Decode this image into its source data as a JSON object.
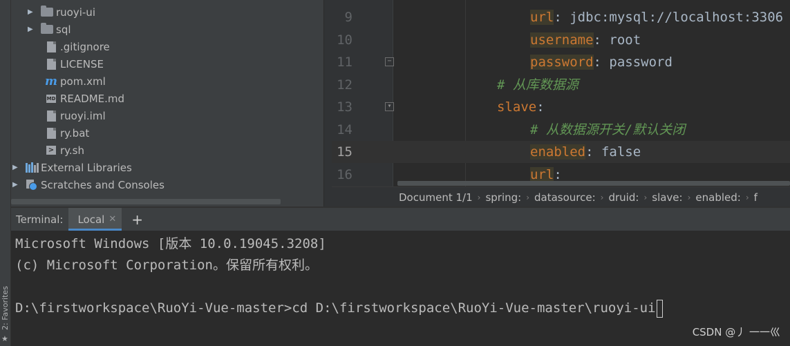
{
  "project_tree": [
    {
      "label": "ruoyi-ui",
      "icon": "folder-icon",
      "expandable": true
    },
    {
      "label": "sql",
      "icon": "folder-icon",
      "expandable": true
    },
    {
      "label": ".gitignore",
      "icon": "gitignore-file-icon",
      "expandable": false
    },
    {
      "label": "LICENSE",
      "icon": "text-file-icon",
      "expandable": false
    },
    {
      "label": "pom.xml",
      "icon": "maven-icon",
      "expandable": false
    },
    {
      "label": "README.md",
      "icon": "markdown-file-icon",
      "expandable": false
    },
    {
      "label": "ruoyi.iml",
      "icon": "iml-file-icon",
      "expandable": false
    },
    {
      "label": "ry.bat",
      "icon": "bat-file-icon",
      "expandable": false
    },
    {
      "label": "ry.sh",
      "icon": "shell-file-icon",
      "expandable": false
    },
    {
      "label": "External Libraries",
      "icon": "library-icon",
      "expandable": true
    },
    {
      "label": "Scratches and Consoles",
      "icon": "scratches-icon",
      "expandable": true
    }
  ],
  "editor": {
    "current_line": 15,
    "lines": [
      {
        "num": "9",
        "key": "url",
        "sep": ": ",
        "value": "jdbc:mysql://localhost:3306"
      },
      {
        "num": "10",
        "key": "username",
        "sep": ": ",
        "value": "root"
      },
      {
        "num": "11",
        "key": "password",
        "sep": ": ",
        "value": "password"
      },
      {
        "num": "12",
        "comment": "# 从库数据源"
      },
      {
        "num": "13",
        "key": "slave",
        "sep": ":",
        "value": ""
      },
      {
        "num": "14",
        "comment": "# 从数据源开关/默认关闭"
      },
      {
        "num": "15",
        "key": "enabled",
        "sep": ": ",
        "value": "false"
      },
      {
        "num": "16",
        "key": "url",
        "sep": ":",
        "value": ""
      }
    ]
  },
  "breadcrumb": [
    "Document 1/1",
    "spring:",
    "datasource:",
    "druid:",
    "slave:",
    "enabled:",
    "f"
  ],
  "terminal": {
    "title": "Terminal:",
    "tab_label": "Local",
    "add_label": "+",
    "lines": [
      "Microsoft Windows [版本 10.0.19045.3208]",
      "(c) Microsoft Corporation。保留所有权利。",
      "",
      "D:\\firstworkspace\\RuoYi-Vue-master>cd D:\\firstworkspace\\RuoYi-Vue-master\\ruoyi-ui"
    ]
  },
  "side_tool": {
    "favorites_label": "2: Favorites"
  },
  "watermark": "CSDN @丿 一一巛",
  "colors": {
    "keyword": "#cc7832",
    "comment": "#629755",
    "text": "#a9b7c6",
    "accent": "#4a88c7"
  }
}
